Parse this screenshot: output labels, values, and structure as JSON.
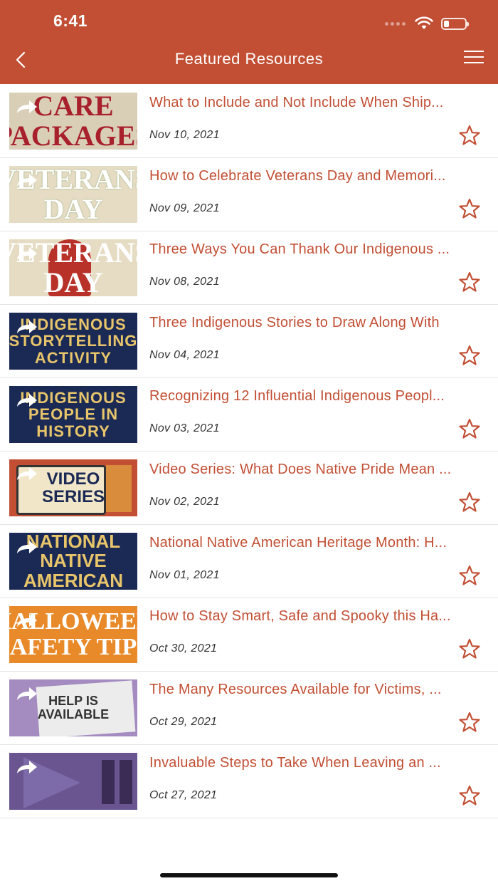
{
  "status_bar": {
    "time": "6:41"
  },
  "nav": {
    "title": "Featured Resources"
  },
  "colors": {
    "brand": "#c24f34",
    "text_dark": "#333333",
    "divider": "#e4e4e4"
  },
  "items": [
    {
      "title": "What to Include and Not Include When Ship...",
      "date": "Nov 10, 2021",
      "thumb_text": "CARE\nPACKAGES"
    },
    {
      "title": "How to Celebrate Veterans Day and Memori...",
      "date": "Nov 09, 2021",
      "thumb_text": "VETERANS\nDAY"
    },
    {
      "title": "Three Ways You Can Thank Our Indigenous ...",
      "date": "Nov 08, 2021",
      "thumb_text": "VETERANS\nDAY"
    },
    {
      "title": "Three Indigenous Stories to Draw Along With",
      "date": "Nov 04, 2021",
      "thumb_text": "INDIGENOUS\nSTORYTELLING\nACTIVITY"
    },
    {
      "title": "Recognizing 12 Influential Indigenous Peopl...",
      "date": "Nov 03, 2021",
      "thumb_text": "INDIGENOUS\nPEOPLE IN\nHISTORY"
    },
    {
      "title": "Video Series: What Does Native Pride Mean ...",
      "date": "Nov 02, 2021",
      "thumb_text": "VIDEO\nSERIES"
    },
    {
      "title": "National Native American Heritage Month: H...",
      "date": "Nov 01, 2021",
      "thumb_text": "NATIONAL\nNATIVE\nAMERICAN"
    },
    {
      "title": "How to Stay Smart, Safe and Spooky this Ha...",
      "date": "Oct 30, 2021",
      "thumb_text": "HALLOWEEN\nSAFETY TIPS"
    },
    {
      "title": "The Many Resources Available for Victims, ...",
      "date": "Oct 29, 2021",
      "thumb_text": "HELP IS\nAVAILABLE"
    },
    {
      "title": "Invaluable Steps to Take When Leaving an ...",
      "date": "Oct 27, 2021",
      "thumb_text": ""
    }
  ]
}
